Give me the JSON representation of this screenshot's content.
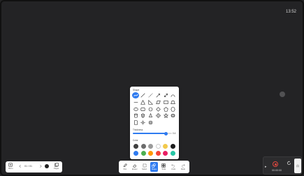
{
  "clock": "13:52",
  "shape_panel": {
    "shape_title": "Shape",
    "thickness_title": "Thickness",
    "thickness_value": "0.4",
    "thickness_fraction": 0.85,
    "color_title": "Color",
    "shapes": [
      {
        "icon": "freehand-icon",
        "selected": true
      },
      {
        "icon": "line-icon"
      },
      {
        "icon": "dashed-line-icon"
      },
      {
        "icon": "arrow-icon"
      },
      {
        "icon": "double-arrow-icon"
      },
      {
        "icon": "curve-icon"
      },
      {
        "icon": "horizontal-line-icon"
      },
      {
        "icon": "triangle-icon"
      },
      {
        "icon": "right-triangle-icon"
      },
      {
        "icon": "parallelogram-icon"
      },
      {
        "icon": "rectangle-icon"
      },
      {
        "icon": "trapezoid-icon"
      },
      {
        "icon": "ellipse-icon"
      },
      {
        "icon": "rounded-rect-icon"
      },
      {
        "icon": "circle-icon"
      },
      {
        "icon": "diamond-icon"
      },
      {
        "icon": "pentagon-icon"
      },
      {
        "icon": "hexagon-icon"
      },
      {
        "icon": "cylinder-icon"
      },
      {
        "icon": "cube-icon"
      },
      {
        "icon": "cone-icon"
      },
      {
        "icon": "cross-icon"
      },
      {
        "icon": "star-icon"
      },
      {
        "icon": "sphere-icon"
      },
      {
        "icon": "doc-shape-icon"
      },
      {
        "icon": "sun-icon"
      },
      {
        "icon": "ring-icon"
      }
    ],
    "colors": [
      "#3f3f3f",
      "#6c6c6c",
      "#9a9a9a",
      "#ffffff",
      "#f2c94c",
      "#1c1c1c",
      "#2f7bf0",
      "#4caf50",
      "#ff9800",
      "#f44336",
      "#e91e63",
      "#26c6a5"
    ]
  },
  "toolbar": {
    "items": [
      {
        "label": "Pen",
        "icon": "pen-icon"
      },
      {
        "label": "Eraser",
        "icon": "eraser-icon"
      },
      {
        "label": "Select",
        "icon": "select-icon"
      },
      {
        "label": "Shape",
        "icon": "shape-icon",
        "active": true
      },
      {
        "label": "Tools",
        "icon": "tools-icon"
      },
      {
        "label": "Undo",
        "icon": "undo-icon"
      },
      {
        "label": "Redo",
        "icon": "redo-icon"
      }
    ]
  },
  "left_toolbar": {
    "menu_label": "Menu",
    "page_text": "01 / 01",
    "pages_label": "Pages"
  },
  "recorder": {
    "time": "00:00:00"
  }
}
